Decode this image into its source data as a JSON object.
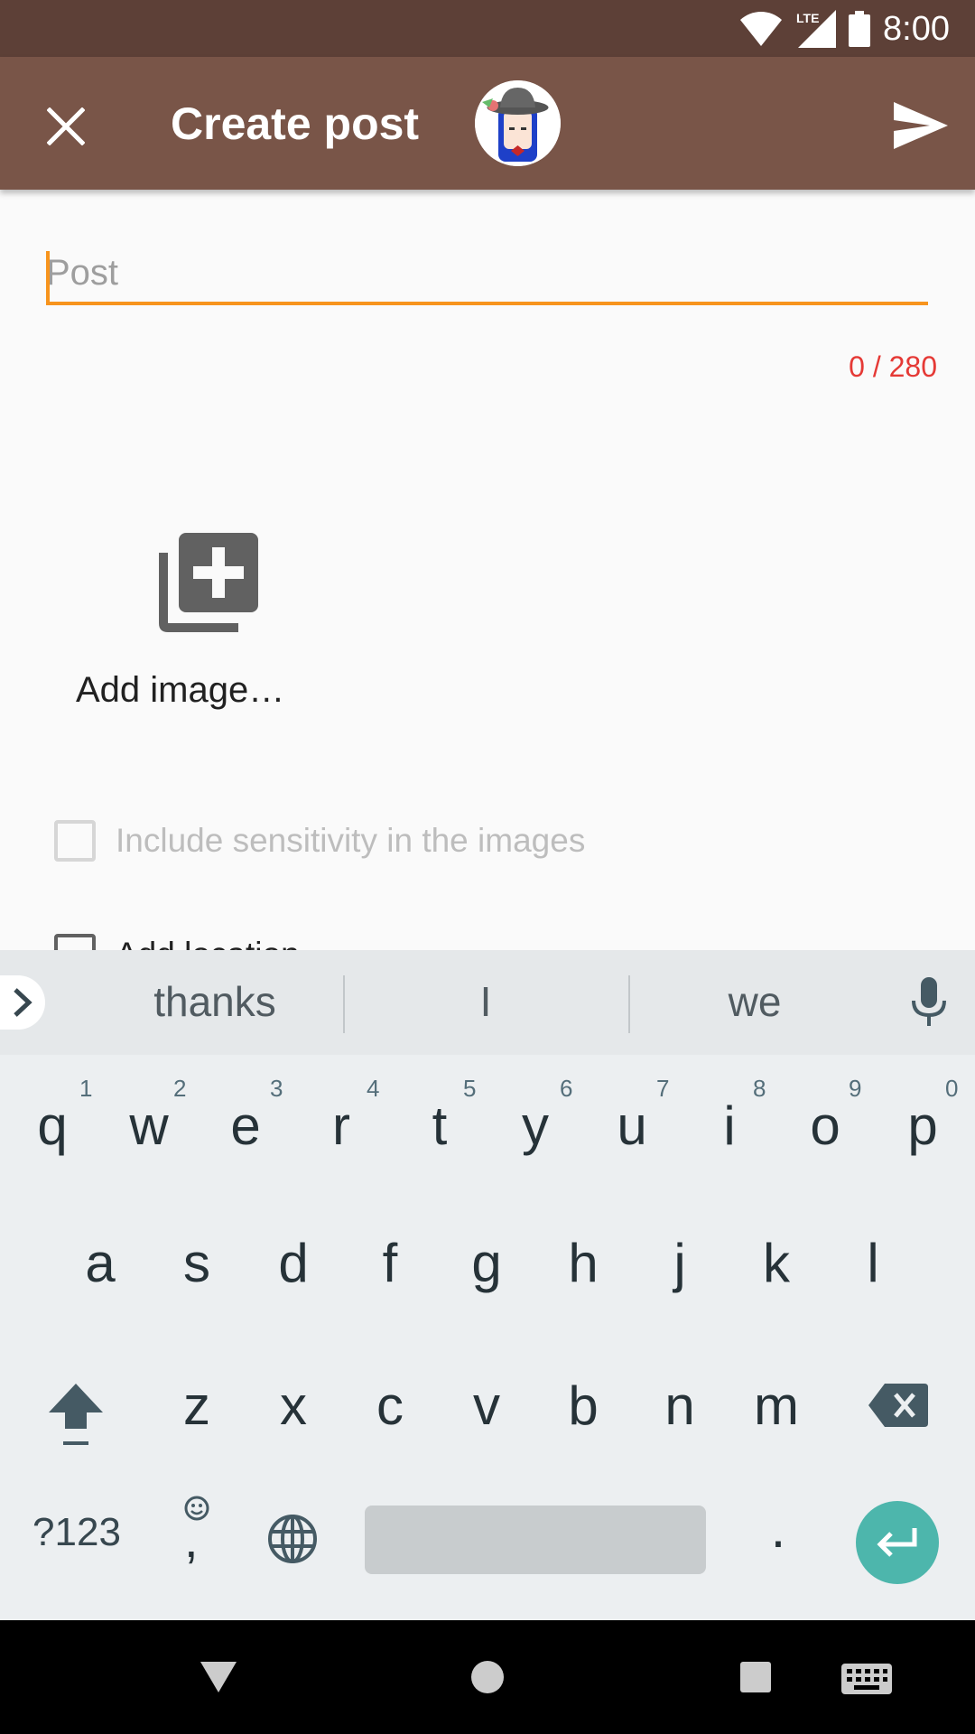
{
  "status_bar": {
    "time": "8:00",
    "network_label": "LTE",
    "icons": [
      "wifi-icon",
      "lte-signal-icon",
      "battery-icon"
    ]
  },
  "app_bar": {
    "title": "Create post",
    "close_icon": "close-icon",
    "send_icon": "send-icon",
    "avatar": "user-avatar"
  },
  "composer": {
    "placeholder": "Post",
    "value": "",
    "counter": "0 / 280"
  },
  "add_image": {
    "label": "Add image…",
    "icon": "add-photo-library-icon"
  },
  "options": [
    {
      "label": "Include sensitivity in the images",
      "checked": false,
      "enabled": false
    },
    {
      "label": "Add location",
      "checked": false,
      "enabled": true
    }
  ],
  "keyboard": {
    "suggestions": [
      "thanks",
      "I",
      "we"
    ],
    "row1": [
      "q",
      "w",
      "e",
      "r",
      "t",
      "y",
      "u",
      "i",
      "o",
      "p"
    ],
    "row1_hints": [
      "1",
      "2",
      "3",
      "4",
      "5",
      "6",
      "7",
      "8",
      "9",
      "0"
    ],
    "row2": [
      "a",
      "s",
      "d",
      "f",
      "g",
      "h",
      "j",
      "k",
      "l"
    ],
    "row3": [
      "z",
      "x",
      "c",
      "v",
      "b",
      "n",
      "m"
    ],
    "symbols_key": "?123",
    "comma_key": ",",
    "period_key": "."
  },
  "colors": {
    "status_bar": "#5d4037",
    "app_bar": "#795548",
    "accent": "#f7941d",
    "counter": "#e53935",
    "enter_key": "#4db6ac"
  }
}
